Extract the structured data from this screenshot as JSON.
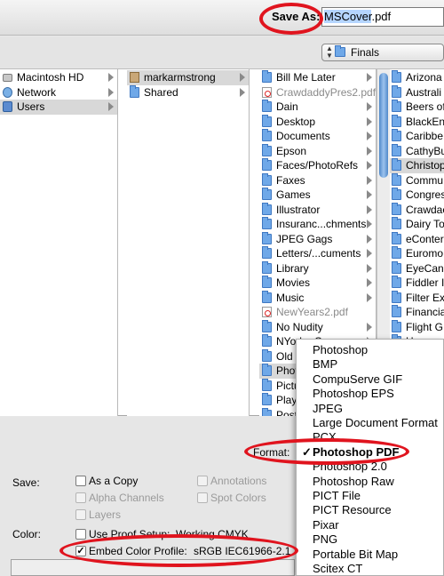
{
  "save_as": {
    "label": "Save As:",
    "filename": "MSCover.pdf",
    "filename_selected_part": "MSCover"
  },
  "location": {
    "folder": "Finals"
  },
  "columns": {
    "col1": [
      {
        "name": "Macintosh HD",
        "icon": "disk-icon",
        "arrow": true
      },
      {
        "name": "Network",
        "icon": "globe-icon",
        "arrow": true
      },
      {
        "name": "Users",
        "icon": "users-icon",
        "arrow": true,
        "selected": true
      }
    ],
    "col2": [
      {
        "name": "markarmstrong",
        "icon": "home-icon",
        "arrow": true,
        "selected": true
      },
      {
        "name": "Shared",
        "icon": "folder-icon",
        "arrow": true
      }
    ],
    "col3": [
      {
        "name": "Bill Me Later",
        "icon": "folder-icon",
        "arrow": true
      },
      {
        "name": "CrawdaddyPres2.pdf",
        "icon": "pdf-icon",
        "dim": true
      },
      {
        "name": "Dain",
        "icon": "folder-icon",
        "arrow": true
      },
      {
        "name": "Desktop",
        "icon": "folder-icon",
        "arrow": true
      },
      {
        "name": "Documents",
        "icon": "folder-icon",
        "arrow": true
      },
      {
        "name": "Epson",
        "icon": "folder-icon",
        "arrow": true
      },
      {
        "name": "Faces/PhotoRefs",
        "icon": "folder-icon",
        "arrow": true
      },
      {
        "name": "Faxes",
        "icon": "folder-icon",
        "arrow": true
      },
      {
        "name": "Games",
        "icon": "folder-icon",
        "arrow": true
      },
      {
        "name": "Illustrator",
        "icon": "folder-icon",
        "arrow": true
      },
      {
        "name": "Insuranc...chments",
        "icon": "folder-icon",
        "arrow": true
      },
      {
        "name": "JPEG Gags",
        "icon": "folder-icon",
        "arrow": true
      },
      {
        "name": "Letters/...cuments",
        "icon": "folder-icon",
        "arrow": true
      },
      {
        "name": "Library",
        "icon": "folder-icon",
        "arrow": true
      },
      {
        "name": "Movies",
        "icon": "folder-icon",
        "arrow": true
      },
      {
        "name": "Music",
        "icon": "folder-icon",
        "arrow": true
      },
      {
        "name": "NewYears2.pdf",
        "icon": "pdf-icon",
        "dim": true
      },
      {
        "name": "No Nudity",
        "icon": "folder-icon",
        "arrow": true
      },
      {
        "name": "NYorkerCovers",
        "icon": "folder-icon",
        "arrow": true
      },
      {
        "name": "Old",
        "icon": "folder-icon",
        "arrow": true
      },
      {
        "name": "Phot",
        "icon": "folder-icon",
        "arrow": true,
        "selected": true
      },
      {
        "name": "Pictu",
        "icon": "folder-icon",
        "arrow": true
      },
      {
        "name": "Playi",
        "icon": "folder-icon",
        "arrow": true
      },
      {
        "name": "Post",
        "icon": "folder-icon",
        "arrow": true
      }
    ],
    "col4": [
      {
        "name": "Arizona",
        "icon": "folder-icon"
      },
      {
        "name": "Australi",
        "icon": "folder-icon"
      },
      {
        "name": "Beers of",
        "icon": "folder-icon"
      },
      {
        "name": "BlackEn",
        "icon": "folder-icon"
      },
      {
        "name": "Caribbe",
        "icon": "folder-icon"
      },
      {
        "name": "CathyBu",
        "icon": "folder-icon"
      },
      {
        "name": "Christop",
        "icon": "folder-icon",
        "selected": true
      },
      {
        "name": "Commu",
        "icon": "folder-icon"
      },
      {
        "name": "Congres",
        "icon": "folder-icon"
      },
      {
        "name": "Crawdac",
        "icon": "folder-icon"
      },
      {
        "name": "Dairy To",
        "icon": "folder-icon"
      },
      {
        "name": "eConter",
        "icon": "folder-icon"
      },
      {
        "name": "Euromo",
        "icon": "folder-icon"
      },
      {
        "name": "EyeCanc",
        "icon": "folder-icon"
      },
      {
        "name": "Fiddler I",
        "icon": "folder-icon"
      },
      {
        "name": "Filter Ex",
        "icon": "folder-icon"
      },
      {
        "name": "Financia",
        "icon": "folder-icon"
      },
      {
        "name": "Flight G",
        "icon": "folder-icon"
      },
      {
        "name": "Hu",
        "icon": "folder-icon"
      }
    ]
  },
  "options": {
    "save_label": "Save:",
    "color_label": "Color:",
    "format_label": "Format:",
    "as_a_copy": "As a Copy",
    "alpha_channels": "Alpha Channels",
    "layers": "Layers",
    "annotations": "Annotations",
    "spot_colors": "Spot Colors",
    "use_proof_setup": "Use Proof Setup:",
    "working_cmyk": "Working CMYK",
    "embed_color_profile": "Embed Color Profile:",
    "profile_value": "sRGB IEC61966-2.1"
  },
  "format_menu": {
    "items": [
      "Photoshop",
      "BMP",
      "CompuServe GIF",
      "Photoshop EPS",
      "JPEG",
      "Large Document Format",
      "PCX",
      "Photoshop PDF",
      "Photoshop 2.0",
      "Photoshop Raw",
      "PICT File",
      "PICT Resource",
      "Pixar",
      "PNG",
      "Portable Bit Map",
      "Scitex CT"
    ],
    "selected_index": 7,
    "check": "✓"
  },
  "colors": {
    "annotation": "#e0141e",
    "selection": "#b5d5ff",
    "folder": "#6fa8e8"
  }
}
